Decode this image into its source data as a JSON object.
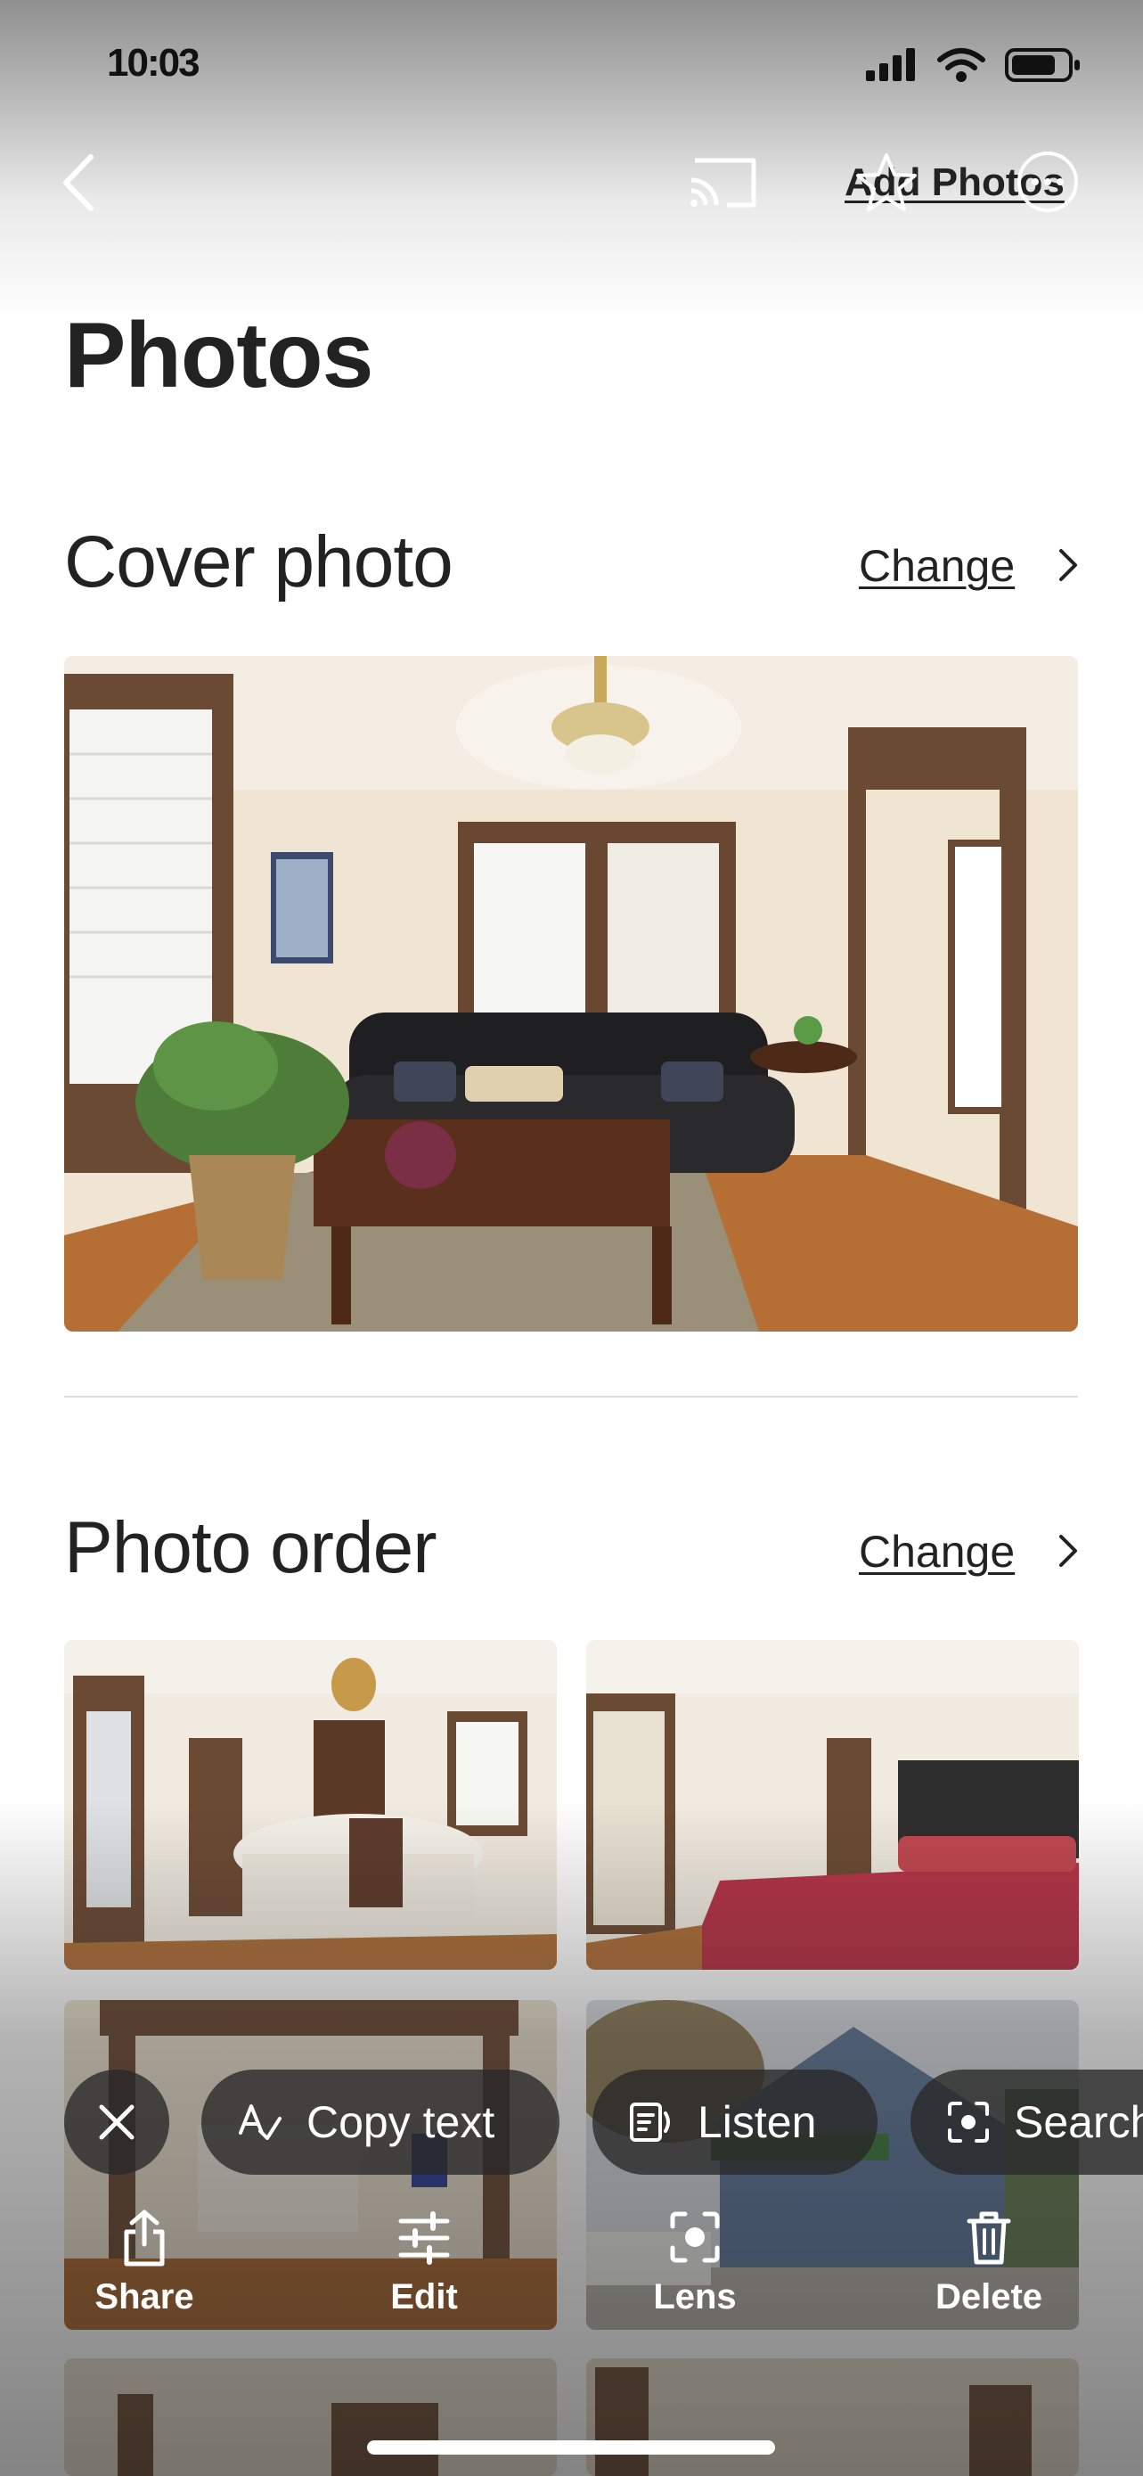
{
  "status_bar": {
    "time": "10:03"
  },
  "nav": {
    "add_photos_label": "Add Photos"
  },
  "page": {
    "title": "Photos"
  },
  "cover": {
    "title": "Cover photo",
    "change_label": "Change"
  },
  "order": {
    "title": "Photo order",
    "change_label": "Change"
  },
  "overlay": {
    "pills": [
      "Copy text",
      "Listen",
      "Search"
    ],
    "actions": [
      "Share",
      "Edit",
      "Lens",
      "Delete"
    ]
  },
  "icons": [
    "signal-icon",
    "wifi-icon",
    "battery-icon",
    "back-icon",
    "cast-icon",
    "star-icon",
    "more-icon",
    "chevron-right-icon",
    "close-icon",
    "copy-text-icon",
    "listen-icon",
    "search-lens-icon",
    "share-icon",
    "edit-icon",
    "lens-icon",
    "delete-icon"
  ]
}
